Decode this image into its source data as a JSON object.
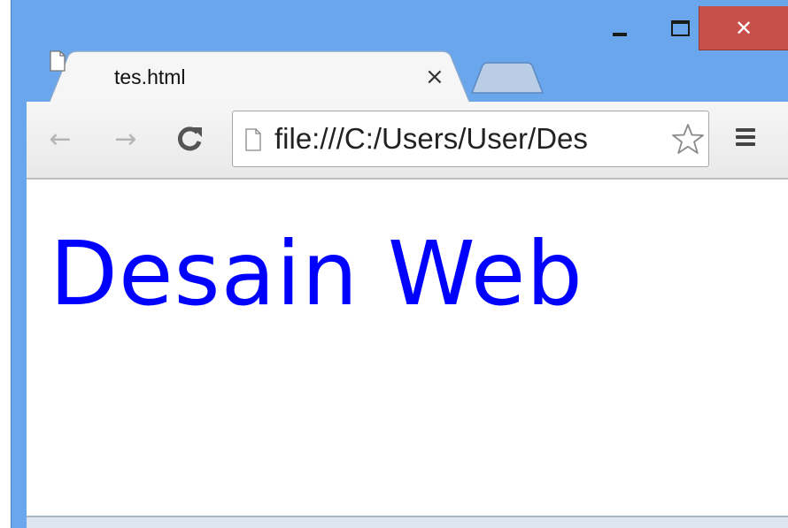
{
  "window": {
    "minimize_icon": "minimize-icon",
    "maximize_icon": "maximize-icon",
    "close_icon": "close-icon",
    "close_glyph": "✕",
    "frame_color": "#6aa6ec",
    "close_color": "#c7514a"
  },
  "tabs": [
    {
      "title": "tes.html",
      "icon": "page-icon",
      "close_glyph": "×",
      "active": true
    }
  ],
  "new_tab": {
    "icon": "new-tab-icon"
  },
  "toolbar": {
    "back_glyph": "←",
    "forward_glyph": "→",
    "reload_glyph": "C",
    "url": "file:///C:/Users/User/Des",
    "star_icon": "star-icon",
    "menu_icon": "menu-icon"
  },
  "content": {
    "heading": "Desain Web",
    "heading_color": "#0000ff"
  }
}
